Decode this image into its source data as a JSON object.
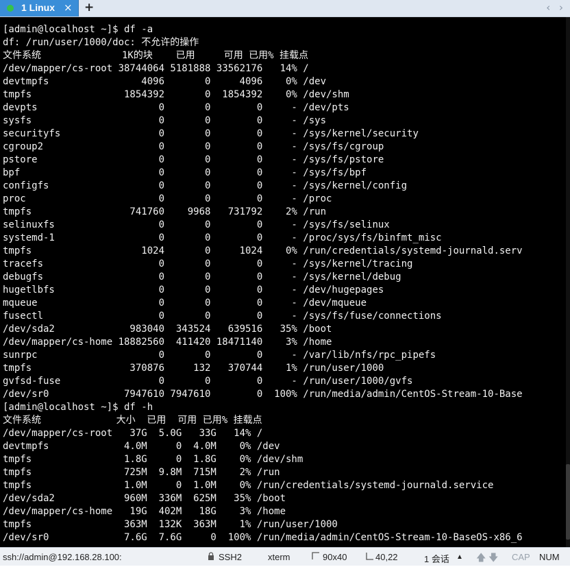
{
  "tab": {
    "title": "1 Linux",
    "close": "×",
    "new_tab": "+",
    "nav_prev": "‹",
    "nav_next": "›"
  },
  "terminal": {
    "lines": [
      "[admin@localhost ~]$ df -a",
      "df: /run/user/1000/doc: 不允许的操作",
      "文件系统              1K的块    已用     可用 已用% 挂载点",
      "/dev/mapper/cs-root 38744064 5181888 33562176   14% /",
      "devtmpfs                4096       0     4096    0% /dev",
      "tmpfs                1854392       0  1854392    0% /dev/shm",
      "devpts                     0       0        0     - /dev/pts",
      "sysfs                      0       0        0     - /sys",
      "securityfs                 0       0        0     - /sys/kernel/security",
      "cgroup2                    0       0        0     - /sys/fs/cgroup",
      "pstore                     0       0        0     - /sys/fs/pstore",
      "bpf                        0       0        0     - /sys/fs/bpf",
      "configfs                   0       0        0     - /sys/kernel/config",
      "proc                       0       0        0     - /proc",
      "tmpfs                 741760    9968   731792    2% /run",
      "selinuxfs                  0       0        0     - /sys/fs/selinux",
      "systemd-1                  0       0        0     - /proc/sys/fs/binfmt_misc",
      "tmpfs                   1024       0     1024    0% /run/credentials/systemd-journald.serv",
      "tracefs                    0       0        0     - /sys/kernel/tracing",
      "debugfs                    0       0        0     - /sys/kernel/debug",
      "hugetlbfs                  0       0        0     - /dev/hugepages",
      "mqueue                     0       0        0     - /dev/mqueue",
      "fusectl                    0       0        0     - /sys/fs/fuse/connections",
      "/dev/sda2             983040  343524   639516   35% /boot",
      "/dev/mapper/cs-home 18882560  411420 18471140    3% /home",
      "sunrpc                     0       0        0     - /var/lib/nfs/rpc_pipefs",
      "tmpfs                 370876     132   370744    1% /run/user/1000",
      "gvfsd-fuse                 0       0        0     - /run/user/1000/gvfs",
      "/dev/sr0             7947610 7947610        0  100% /run/media/admin/CentOS-Stream-10-Base",
      "[admin@localhost ~]$ df -h",
      "文件系统             大小  已用  可用 已用% 挂载点",
      "/dev/mapper/cs-root   37G  5.0G   33G   14% /",
      "devtmpfs             4.0M     0  4.0M    0% /dev",
      "tmpfs                1.8G     0  1.8G    0% /dev/shm",
      "tmpfs                725M  9.8M  715M    2% /run",
      "tmpfs                1.0M     0  1.0M    0% /run/credentials/systemd-journald.service",
      "/dev/sda2            960M  336M  625M   35% /boot",
      "/dev/mapper/cs-home   19G  402M   18G    3% /home",
      "tmpfs                363M  132K  363M    1% /run/user/1000",
      "/dev/sr0             7.6G  7.6G     0  100% /run/media/admin/CentOS-Stream-10-BaseOS-x86_6"
    ]
  },
  "statusbar": {
    "connection": "ssh://admin@192.168.28.100:",
    "protocol": "SSH2",
    "terminal_type": "xterm",
    "size": "90x40",
    "cursor": "40,22",
    "sessions": "1 会话",
    "cap": "CAP",
    "num": "NUM",
    "icons": [
      "lock-icon",
      "resize-icon",
      "cursor-position-icon",
      "up-arrow-icon",
      "down-arrow-icon"
    ]
  }
}
